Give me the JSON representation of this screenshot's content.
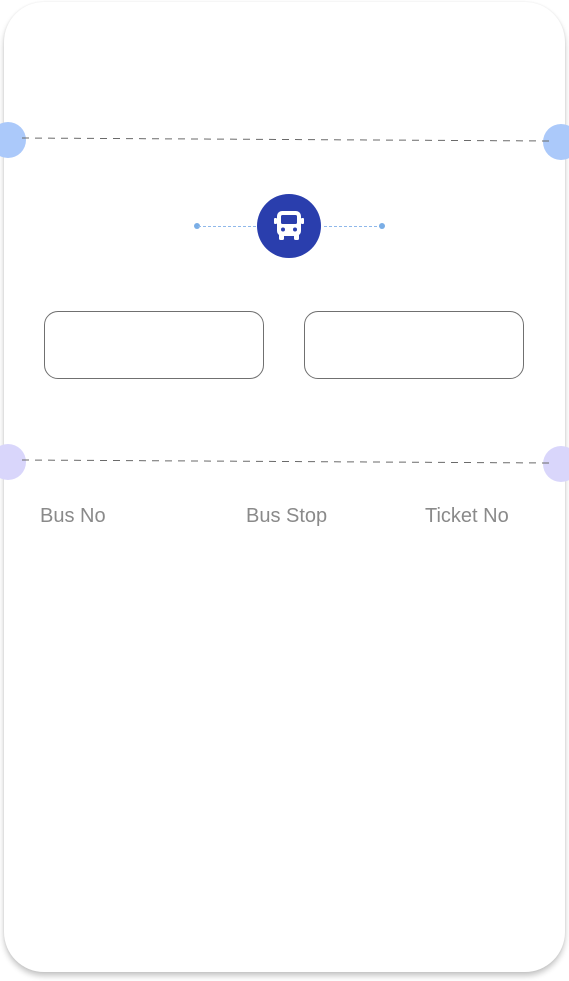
{
  "colors": {
    "notch_top": "#abc9fa",
    "notch_bottom": "#d9d6fb",
    "accent_dark": "#2a3ead",
    "route_dot": "#7aaee6",
    "label_text": "#8a8a8a",
    "cut_line": "#6a6a6a"
  },
  "route": {
    "icon": "bus-icon"
  },
  "details": {
    "bus_no_label": "Bus No",
    "bus_stop_label": "Bus Stop",
    "ticket_no_label": "Ticket No"
  }
}
